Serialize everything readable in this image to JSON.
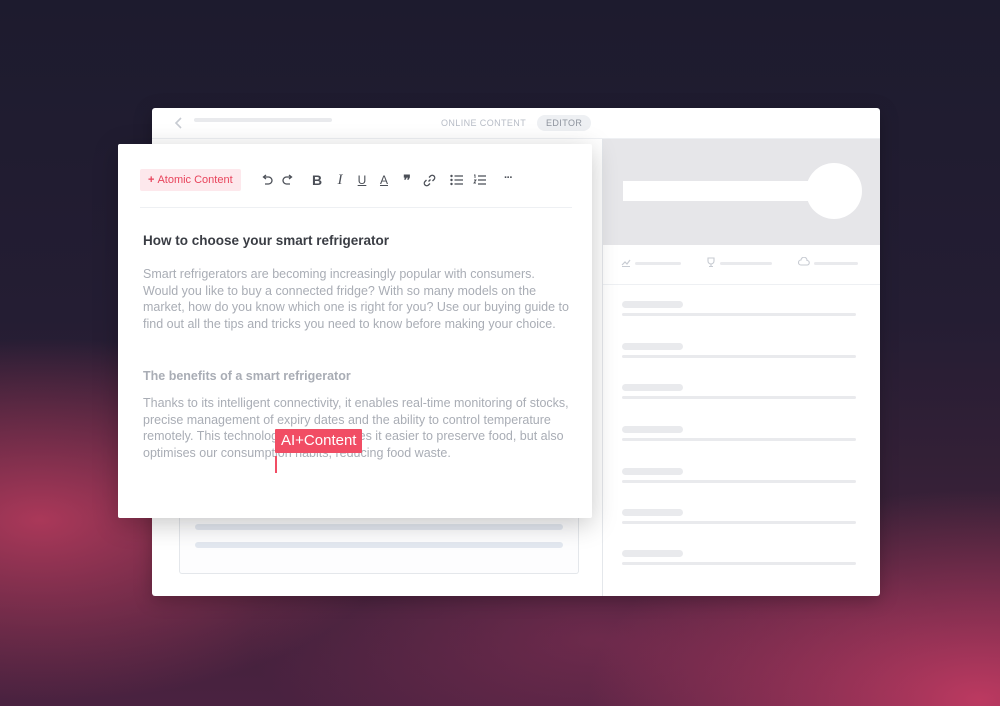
{
  "window": {
    "breadcrumb": {
      "section": "ONLINE CONTENT",
      "current": "EDITOR"
    },
    "icons": {
      "back": "chevron-left-icon",
      "stat1": "chart-icon",
      "stat2": "trophy-icon",
      "stat3": "cloud-icon"
    }
  },
  "editor": {
    "toolbar": {
      "atomic_plus": "+",
      "atomic_label": "Atomic Content",
      "bold": "B",
      "italic": "I",
      "underline": "U",
      "text_color": "A",
      "quote": "❞",
      "more": "···",
      "icons": [
        "undo-icon",
        "redo-icon",
        "link-icon",
        "bullet-list-icon",
        "numbered-list-icon"
      ]
    },
    "title": "How to choose your smart refrigerator",
    "intro": "Smart refrigerators are becoming increasingly popular with consumers. Would you like to buy a connected fridge? With so many models on the market, how do you know which one is right for you? Use our buying guide to find out all the tips and tricks you need to know before making your choice.",
    "subtitle": "The benefits of a smart refrigerator",
    "body": "Thanks to its intelligent connectivity, it enables real-time monitoring of stocks, precise management of expiry dates and the ability to control temperature remotely. This technology not only makes it easier to preserve food, but also optimises our consumption habits, reducing food waste.",
    "ai_tag": "AI+Content"
  },
  "colors": {
    "accent": "#f14d64",
    "atomic_bg": "#fde8ec",
    "atomic_text": "#e8445c",
    "placeholder": "#e9eaed"
  }
}
